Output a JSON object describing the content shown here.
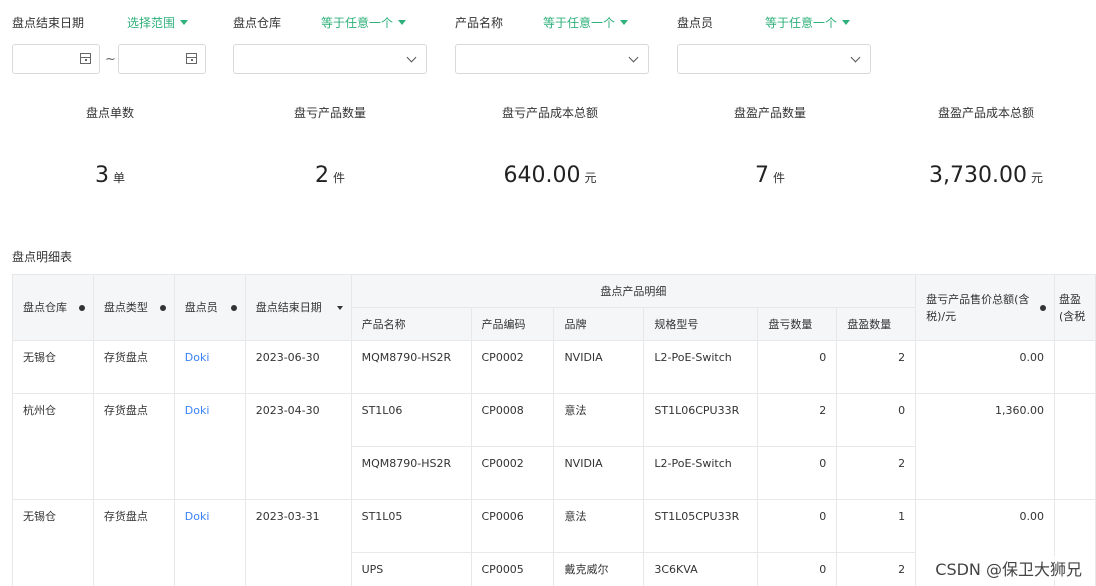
{
  "filters": {
    "end_date": {
      "label": "盘点结束日期",
      "operator": "选择范围",
      "start_value": "",
      "end_value": "",
      "separator": "~"
    },
    "warehouse": {
      "label": "盘点仓库",
      "operator": "等于任意一个",
      "value": ""
    },
    "product_name": {
      "label": "产品名称",
      "operator": "等于任意一个",
      "value": ""
    },
    "checker": {
      "label": "盘点员",
      "operator": "等于任意一个",
      "value": ""
    }
  },
  "stats": [
    {
      "title": "盘点单数",
      "value": "3",
      "unit": "单"
    },
    {
      "title": "盘亏产品数量",
      "value": "2",
      "unit": "件"
    },
    {
      "title": "盘亏产品成本总额",
      "value": "640.00",
      "unit": "元"
    },
    {
      "title": "盘盈产品数量",
      "value": "7",
      "unit": "件"
    },
    {
      "title": "盘盈产品成本总额",
      "value": "3,730.00",
      "unit": "元"
    }
  ],
  "table": {
    "title": "盘点明细表",
    "headers": {
      "warehouse": "盘点仓库",
      "type": "盘点类型",
      "checker": "盘点员",
      "end_date": "盘点结束日期",
      "product_group": "盘点产品明细",
      "product_name": "产品名称",
      "product_code": "产品编码",
      "brand": "品牌",
      "spec": "规格型号",
      "loss_qty": "盘亏数量",
      "gain_qty": "盘盈数量",
      "loss_total": "盘亏产品售价总额(含税)/元",
      "gain_total_partial": "盘盈(含税"
    },
    "records": [
      {
        "warehouse": "无锡仓",
        "type": "存货盘点",
        "checker": "Doki",
        "date": "2023-06-30",
        "loss_total": "0.00",
        "items": [
          {
            "name": "MQM8790-HS2R",
            "code": "CP0002",
            "brand": "NVIDIA",
            "spec": "L2-PoE-Switch",
            "loss": "0",
            "gain": "2"
          }
        ]
      },
      {
        "warehouse": "杭州仓",
        "type": "存货盘点",
        "checker": "Doki",
        "date": "2023-04-30",
        "loss_total": "1,360.00",
        "items": [
          {
            "name": "ST1L06",
            "code": "CP0008",
            "brand": "意法",
            "spec": "ST1L06CPU33R",
            "loss": "2",
            "gain": "0"
          },
          {
            "name": "MQM8790-HS2R",
            "code": "CP0002",
            "brand": "NVIDIA",
            "spec": "L2-PoE-Switch",
            "loss": "0",
            "gain": "2"
          }
        ]
      },
      {
        "warehouse": "无锡仓",
        "type": "存货盘点",
        "checker": "Doki",
        "date": "2023-03-31",
        "loss_total": "0.00",
        "items": [
          {
            "name": "ST1L05",
            "code": "CP0006",
            "brand": "意法",
            "spec": "ST1L05CPU33R",
            "loss": "0",
            "gain": "1"
          },
          {
            "name": "UPS",
            "code": "CP0005",
            "brand": "戴克威尔",
            "spec": "3C6KVA",
            "loss": "0",
            "gain": "2"
          }
        ]
      }
    ]
  },
  "watermark": "CSDN @保卫大狮兄"
}
